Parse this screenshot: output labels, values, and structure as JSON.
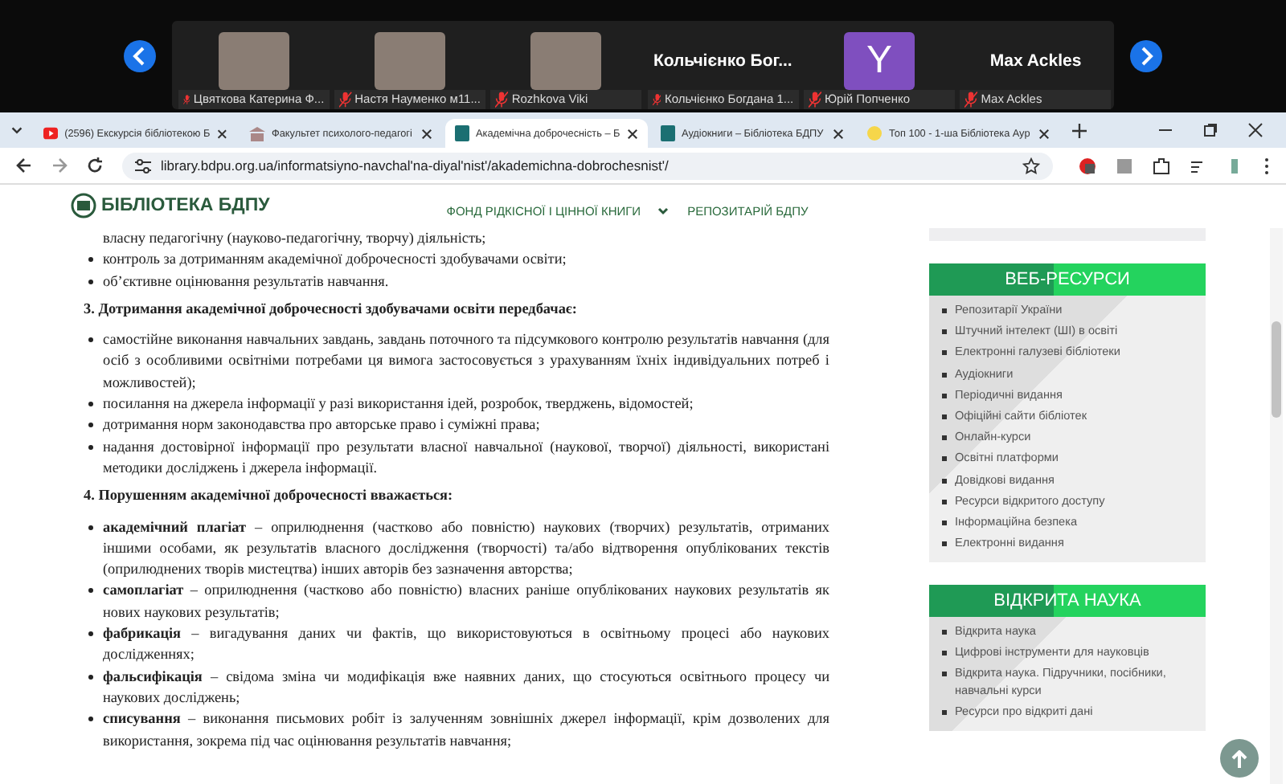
{
  "meeting_strip": {
    "participants": [
      {
        "kind": "photo",
        "name": "Цвяткова Катерина Ф..."
      },
      {
        "kind": "photo",
        "name": "Настя Науменко м11..."
      },
      {
        "kind": "photo",
        "name": "Rozhkova Viki"
      },
      {
        "kind": "text",
        "display": "Кольчієнко Бог...",
        "name": "Кольчієнко Богдана 1..."
      },
      {
        "kind": "avatar",
        "display": "Y",
        "name": "Юрій Попченко"
      },
      {
        "kind": "text",
        "display": "Max Ackles",
        "name": "Max Ackles"
      }
    ]
  },
  "browser": {
    "tabs": [
      {
        "title": "(2596) Екскурсія бібліотекою Б",
        "selected": false
      },
      {
        "title": "Факультет психолого-педагогі",
        "selected": false
      },
      {
        "title": "Академічна доброчесність – Б",
        "selected": true
      },
      {
        "title": "Аудіокниги – Бібліотека БДПУ",
        "selected": false
      },
      {
        "title": "Топ 100 - 1-ша Бібліотека Ayp",
        "selected": false
      }
    ],
    "url": "library.bdpu.org.ua/informatsiyno-navchal'na-diyal'nist'/akademichna-dobrochesnist'/"
  },
  "site": {
    "logo": "БІБЛІОТЕКА БДПУ",
    "nav": [
      {
        "label": "ФОНД РІДКІСНОЇ І ЦІННОЇ КНИГИ",
        "dropdown": true
      },
      {
        "label": "РЕПОЗИТАРІЙ БДПУ",
        "dropdown": false
      }
    ]
  },
  "content": [
    {
      "kind": "continuation",
      "text": "власну педагогічну (науково-педагогічну, творчу) діяльність;"
    },
    {
      "kind": "bullet",
      "text": "контроль за дотриманням академічної доброчесності здобувачами освіти;"
    },
    {
      "kind": "bullet",
      "text": "об’єктивне оцінювання результатів навчання."
    },
    {
      "kind": "heading",
      "text": "3. Дотримання академічної доброчесності здобувачами освіти передбачає:"
    },
    {
      "kind": "bullet",
      "text": "самостійне виконання навчальних завдань, завдань поточного та підсумкового контролю результатів навчання (для осіб з особливими освітніми потребами ця вимога застосовується з урахуванням їхніх індивідуальних потреб і можливостей);"
    },
    {
      "kind": "bullet",
      "text": "посилання на джерела інформації у разі використання ідей, розробок, тверджень, відомостей;"
    },
    {
      "kind": "bullet",
      "text": "дотримання норм законодавства про авторське право і суміжні права;"
    },
    {
      "kind": "bullet",
      "text": "надання достовірної інформації про результати власної навчальної (наукової, творчої) діяльності, використані методики досліджень і джерела інформації."
    },
    {
      "kind": "heading",
      "text": "4. Порушенням академічної доброчесності вважається:"
    },
    {
      "kind": "bullet",
      "text": "**академічний плагіат** – оприлюднення (частково або повністю) наукових (творчих) результатів, отриманих іншими особами, як результатів власного дослідження (творчості) та/або відтворення опублікованих текстів (оприлюднених творів мистецтва) інших авторів без зазначення авторства;"
    },
    {
      "kind": "bullet",
      "text": "**самоплагіат** – оприлюднення (частково або повністю) власних раніше опублікованих наукових результатів як нових наукових результатів;"
    },
    {
      "kind": "bullet",
      "text": "**фабрикація** – вигадування даних чи фактів, що використовуються в освітньому процесі або наукових дослідженнях;"
    },
    {
      "kind": "bullet",
      "text": "**фальсифікація** – свідома зміна чи модифікація вже наявних даних, що стосуються освітнього процесу чи наукових досліджень;"
    },
    {
      "kind": "bullet",
      "text": "**списування** – виконання письмових робіт із залученням зовнішніх джерел інформації, крім дозволених для використання, зокрема під час оцінювання результатів навчання;"
    }
  ],
  "sidebar": [
    {
      "title": "ВЕБ-РЕСУРСИ",
      "items": [
        "Репозитарії України",
        "Штучний інтелект (ШІ) в освіті",
        "Електронні галузеві бібліотеки",
        "Аудіокниги",
        "Періодичні видання",
        "Офіційні сайти бібліотек",
        "Онлайн-курси",
        "Освітні платформи",
        "Довідкові видання",
        "Ресурси відкритого доступу",
        "Інформаційна безпека",
        "Електронні видання"
      ]
    },
    {
      "title": "ВІДКРИТА НАУКА",
      "items": [
        "Відкрита наука",
        "Цифрові інструменти для науковців",
        "Відкрита наука. Підручники, посібники, навчальні курси",
        "Ресурси про відкриті дані"
      ]
    }
  ]
}
